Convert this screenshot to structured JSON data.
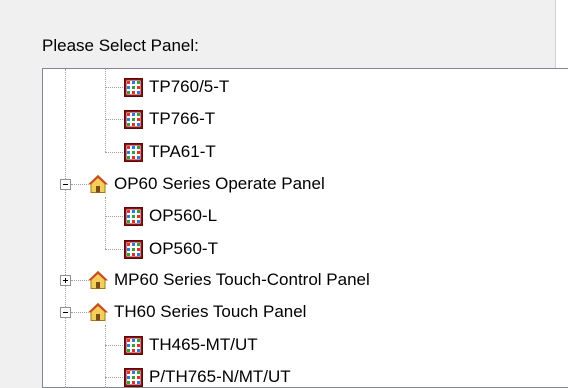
{
  "dialog": {
    "prompt_label": "Please Select Panel:"
  },
  "tree": {
    "items": [
      {
        "label": "TP760/5-T",
        "icon": "panel-icon",
        "level": 2
      },
      {
        "label": "TP766-T",
        "icon": "panel-icon",
        "level": 2
      },
      {
        "label": "TPA61-T",
        "icon": "panel-icon",
        "level": 2
      },
      {
        "label": "OP60 Series Operate Panel",
        "icon": "house-icon",
        "level": 1,
        "expander": "collapse"
      },
      {
        "label": "OP560-L",
        "icon": "panel-icon",
        "level": 2
      },
      {
        "label": "OP560-T",
        "icon": "panel-icon",
        "level": 2
      },
      {
        "label": "MP60 Series Touch-Control Panel",
        "icon": "house-icon",
        "level": 1,
        "expander": "expand"
      },
      {
        "label": "TH60 Series Touch Panel",
        "icon": "house-icon",
        "level": 1,
        "expander": "collapse"
      },
      {
        "label": "TH465-MT/UT",
        "icon": "panel-icon",
        "level": 2
      },
      {
        "label": "P/TH765-N/MT/UT",
        "icon": "panel-icon",
        "level": 2
      }
    ]
  }
}
